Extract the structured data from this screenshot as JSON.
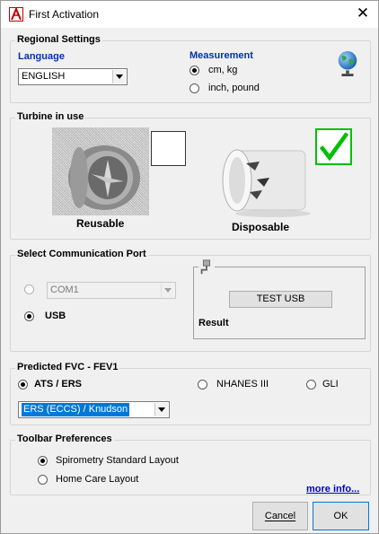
{
  "window": {
    "title": "First Activation",
    "close_glyph": "✕"
  },
  "regional": {
    "legend": "Regional Settings",
    "language_label": "Language",
    "language_value": "ENGLISH",
    "measurement_label": "Measurement",
    "options": [
      {
        "label": "cm, kg",
        "checked": true
      },
      {
        "label": "inch, pound",
        "checked": false
      }
    ],
    "globe_icon": "globe-icon"
  },
  "turbine": {
    "legend": "Turbine in use",
    "reusable_label": "Reusable",
    "reusable_checked": false,
    "disposable_label": "Disposable",
    "disposable_checked": true,
    "check_color": "#00c000"
  },
  "comm": {
    "legend": "Select Communication Port",
    "com_value": "COM1",
    "com_checked": false,
    "usb_label": "USB",
    "usb_checked": true,
    "test_usb_label": "TEST USB",
    "result_label": "Result",
    "usb_icon": "usb-plug-icon"
  },
  "fvc": {
    "legend": "Predicted FVC - FEV1",
    "options": [
      {
        "label": "ATS /  ERS",
        "checked": true
      },
      {
        "label": "NHANES III",
        "checked": false
      },
      {
        "label": "GLI",
        "checked": false
      }
    ],
    "selected_value": "ERS (ECCS) / Knudson"
  },
  "toolbar": {
    "legend": "Toolbar Preferences",
    "options": [
      {
        "label": "Spirometry Standard Layout",
        "checked": true
      },
      {
        "label": "Home Care Layout",
        "checked": false
      }
    ],
    "more_info": "more info..."
  },
  "buttons": {
    "cancel": "Cancel",
    "ok": "OK"
  },
  "colors": {
    "accent_blue": "#0033aa",
    "link_blue": "#0000cc",
    "selection": "#0078d7"
  }
}
